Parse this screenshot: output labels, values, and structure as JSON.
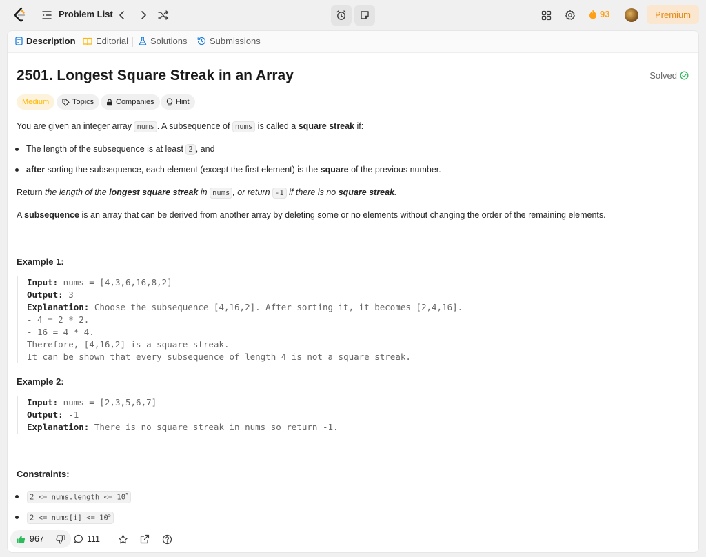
{
  "topbar": {
    "problem_list_label": "Problem List",
    "streak_count": "93",
    "premium_label": "Premium"
  },
  "tabs": [
    {
      "label": "Description",
      "icon": "description-icon",
      "active": true
    },
    {
      "label": "Editorial",
      "icon": "book-icon",
      "active": false
    },
    {
      "label": "Solutions",
      "icon": "flask-icon",
      "active": false
    },
    {
      "label": "Submissions",
      "icon": "history-icon",
      "active": false
    }
  ],
  "problem": {
    "title": "2501. Longest Square Streak in an Array",
    "status": "Solved",
    "difficulty": "Medium",
    "chips": {
      "topics": "Topics",
      "companies": "Companies",
      "hint": "Hint"
    },
    "description": {
      "p1_a": "You are given an integer array ",
      "p1_code1": "nums",
      "p1_b": ". A subsequence of ",
      "p1_code2": "nums",
      "p1_c": " is called a ",
      "p1_bold": "square streak",
      "p1_d": " if:",
      "b1_a": "The length of the subsequence is at least ",
      "b1_code": "2",
      "b1_b": ", and",
      "b2_bold1": "after",
      "b2_a": " sorting the subsequence, each element (except the first element) is the ",
      "b2_bold2": "square",
      "b2_b": " of the previous number.",
      "p2_a": "Return ",
      "p2_i1": "the length of the ",
      "p2_bi1": "longest square streak",
      "p2_i2": " in ",
      "p2_code1": "nums",
      "p2_i3": ", or return ",
      "p2_code2": "-1",
      "p2_i4": " if there is no ",
      "p2_bi2": "square streak",
      "p2_i5": ".",
      "p3_a": "A ",
      "p3_bold": "subsequence",
      "p3_b": " is an array that can be derived from another array by deleting some or no elements without changing the order of the remaining elements."
    },
    "examples": [
      {
        "title": "Example 1:",
        "input_label": "Input:",
        "input": " nums = [4,3,6,16,8,2]",
        "output_label": "Output:",
        "output": " 3",
        "explanation_label": "Explanation:",
        "explanation": " Choose the subsequence [4,16,2]. After sorting it, it becomes [2,4,16].",
        "extra": [
          "- 4 = 2 * 2.",
          "- 16 = 4 * 4.",
          "Therefore, [4,16,2] is a square streak.",
          "It can be shown that every subsequence of length 4 is not a square streak."
        ]
      },
      {
        "title": "Example 2:",
        "input_label": "Input:",
        "input": " nums = [2,3,5,6,7]",
        "output_label": "Output:",
        "output": " -1",
        "explanation_label": "Explanation:",
        "explanation": " There is no square streak in nums so return -1."
      }
    ],
    "constraints_title": "Constraints:",
    "constraints": [
      {
        "text": "2 <= nums.length <= 10",
        "sup": "5"
      },
      {
        "text": "2 <= nums[i] <= 10",
        "sup": "5"
      }
    ]
  },
  "bottombar": {
    "likes": "967",
    "comments": "111"
  },
  "colors": {
    "accent": "#ffa116",
    "medium": "#ffb800",
    "solved": "#2cbb5d",
    "like": "#2cbb5d"
  }
}
